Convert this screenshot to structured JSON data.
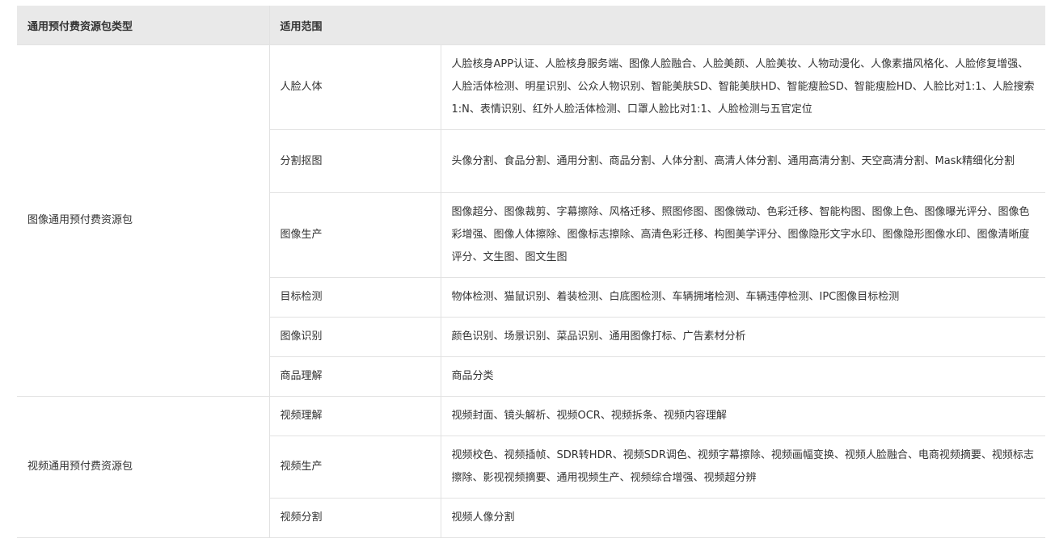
{
  "table": {
    "headers": {
      "type": "通用预付费资源包类型",
      "scope": "适用范围"
    },
    "groups": [
      {
        "type": "图像通用预付费资源包",
        "rows": [
          {
            "scope": "人脸人体",
            "apps": "人脸核身APP认证、人脸核身服务端、图像人脸融合、人脸美颜、人脸美妆、人物动漫化、人像素描风格化、人脸修复增强、人脸活体检测、明星识别、公众人物识别、智能美肤SD、智能美肤HD、智能瘦脸SD、智能瘦脸HD、人脸比对1:1、人脸搜索1:N、表情识别、红外人脸活体检测、口罩人脸比对1:1、人脸检测与五官定位"
          },
          {
            "scope": "分割抠图",
            "apps": "头像分割、食品分割、通用分割、商品分割、人体分割、高清人体分割、通用高清分割、天空高清分割、Mask精细化分割"
          },
          {
            "scope": "图像生产",
            "apps": "图像超分、图像裁剪、字幕擦除、风格迁移、照图修图、图像微动、色彩迁移、智能构图、图像上色、图像曝光评分、图像色彩增强、图像人体擦除、图像标志擦除、高清色彩迁移、构图美学评分、图像隐形文字水印、图像隐形图像水印、图像清晰度评分、文生图、图文生图"
          },
          {
            "scope": "目标检测",
            "apps": "物体检测、猫鼠识别、着装检测、白底图检测、车辆拥堵检测、车辆违停检测、IPC图像目标检测"
          },
          {
            "scope": "图像识别",
            "apps": "颜色识别、场景识别、菜品识别、通用图像打标、广告素材分析"
          },
          {
            "scope": "商品理解",
            "apps": "商品分类"
          }
        ]
      },
      {
        "type": "视频通用预付费资源包",
        "rows": [
          {
            "scope": "视频理解",
            "apps": "视频封面、镜头解析、视频OCR、视频拆条、视频内容理解"
          },
          {
            "scope": "视频生产",
            "apps": "视频校色、视频插帧、SDR转HDR、视频SDR调色、视频字幕擦除、视频画幅变换、视频人脸融合、电商视频摘要、视频标志擦除、影视视频摘要、通用视频生产、视频综合增强、视频超分辨"
          },
          {
            "scope": "视频分割",
            "apps": "视频人像分割"
          }
        ]
      }
    ]
  }
}
